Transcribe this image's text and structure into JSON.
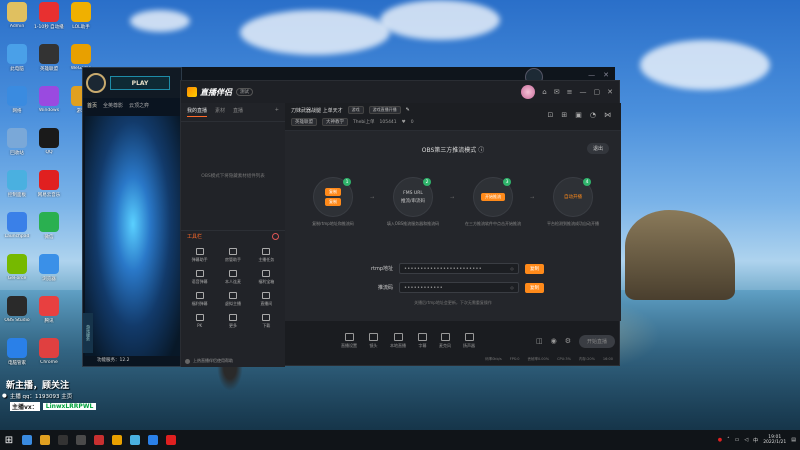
{
  "desktop": {
    "icons": [
      {
        "label": "Admin",
        "color": "#e0c060"
      },
      {
        "label": "1-10秒 自动播放",
        "color": "#e83030"
      },
      {
        "label": "LOL助手",
        "color": "#f0b000"
      },
      {
        "label": "此电脑",
        "color": "#4aa0e8"
      },
      {
        "label": "英雄联盟",
        "color": "#333333"
      },
      {
        "label": "WeGame",
        "color": "#e8a000"
      },
      {
        "label": "网络",
        "color": "#3a8be0"
      },
      {
        "label": "Windows",
        "color": "#9a4ae0"
      },
      {
        "label": "游戏",
        "color": "#e0a020"
      },
      {
        "label": "回收站",
        "color": "#7aa8d8"
      },
      {
        "label": "QQ",
        "color": "#1a1a1a"
      },
      {
        "label": "控制面板",
        "color": "#4ab0e0"
      },
      {
        "label": "网易云音乐",
        "color": "#e02020"
      },
      {
        "label": "Launchpad",
        "color": "#3a80e8"
      },
      {
        "label": "微信",
        "color": "#2ab050"
      },
      {
        "label": "GeForce",
        "color": "#76b900"
      },
      {
        "label": "浏览器",
        "color": "#3a90e8"
      },
      {
        "label": "OBS Studio",
        "color": "#2a2a2a"
      },
      {
        "label": "腾讯",
        "color": "#e84040"
      },
      {
        "label": "电脑管家",
        "color": "#2a80e8"
      },
      {
        "label": "Chrome",
        "color": "#e04040"
      }
    ],
    "overlay": {
      "line1": "新主播，顾关注",
      "line2": "主播 qq：1193093 主页",
      "line3_prefix": "主播vx：",
      "line3_value": "LinwxLRRPWL"
    }
  },
  "lol_client": {
    "play_label": "PLAY",
    "tabs": [
      "首页",
      "全英尊影",
      "云顶之弈"
    ],
    "side_label": "游戏服务",
    "footer": "功能服务：12.2"
  },
  "app": {
    "name": "直播伴侣",
    "version_badge": "测试",
    "left_tabs": [
      "我的直播",
      "素材",
      "直播",
      "+"
    ],
    "left_empty_hint": "OBS模式下将隐藏素材组件列表",
    "tools_header": "工具栏",
    "tools": [
      {
        "label": "弹幕助手"
      },
      {
        "label": "房管助手"
      },
      {
        "label": "主播任务"
      },
      {
        "label": "语音弹幕"
      },
      {
        "label": "本人连麦"
      },
      {
        "label": "福利宝箱"
      },
      {
        "label": "福利弹幕"
      },
      {
        "label": "虚拟主播"
      },
      {
        "label": "直播间"
      },
      {
        "label": "PK"
      },
      {
        "label": "更多"
      },
      {
        "label": "下载"
      }
    ],
    "left_footer": "上热直播伴侣使用帮助",
    "room": {
      "title": "刀妹武器战腿 上单天才",
      "category": "游戏",
      "status": "游戏直播开播",
      "tag1": "英雄联盟",
      "tag2": "大神教学",
      "host": "Thebi上单",
      "fans": "105441",
      "likes": "0"
    },
    "obs": {
      "title": "OBS第三方推流模式",
      "exit_label": "退出",
      "steps": [
        {
          "num": "1",
          "btn_top": "复制",
          "btn_bottom": "复制",
          "desc": "复制rtmp地址和推流码"
        },
        {
          "num": "2",
          "line1": "FMS URL",
          "line2": "推流/串流码",
          "desc": "填入OBS推流服务器和推流码"
        },
        {
          "num": "3",
          "btn": "开始推流",
          "desc": "在三方推流软件中点击开始推流"
        },
        {
          "num": "4",
          "line1": "自动开播",
          "desc": "平台检测到推流成功自动开播"
        }
      ],
      "fields": [
        {
          "label": "rtmp地址",
          "value": "••••••••••••••••••••••••",
          "copy": "复制"
        },
        {
          "label": "推流码",
          "value": "••••••••••••",
          "copy": "复制"
        }
      ],
      "note": "关播后rtmp地址会更新，下次无需重复操作"
    },
    "bottom_tools": [
      {
        "label": "直播设置"
      },
      {
        "label": "镜头"
      },
      {
        "label": "本地直播"
      },
      {
        "label": "字幕"
      },
      {
        "label": "麦克风"
      },
      {
        "label": "扬声器"
      }
    ],
    "start_label": "开始直播",
    "status": [
      "码率0kb/s",
      "FPS:0",
      "丢帧率0.00%",
      "CPU:3%",
      "内存:20%",
      "16:00"
    ]
  },
  "taskbar": {
    "time": "19:01",
    "date": "2022/1/21",
    "icons": [
      "#3a8be0",
      "#e0a020",
      "#333333",
      "#4a4a4a",
      "#c83030",
      "#e8a000",
      "#4ab0e0",
      "#2a80e8",
      "#e02020"
    ]
  }
}
